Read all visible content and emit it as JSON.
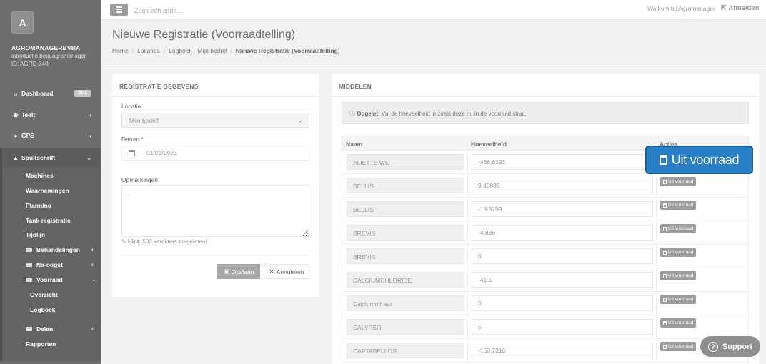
{
  "sidebar": {
    "avatar_letter": "A",
    "company": "AGROMANAGERBVBA",
    "domain": "introductie.beta.agromanager",
    "id": "ID: AGRO-340",
    "nav": [
      {
        "label": "Dashboard",
        "icon": "home-icon",
        "badge": "Beta"
      },
      {
        "label": "Teelt",
        "icon": "leaf-icon"
      },
      {
        "label": "GPS",
        "icon": "map-marker-icon"
      },
      {
        "label": "Spuitschrift",
        "icon": "tint-icon"
      }
    ],
    "sub": [
      "Machines",
      "Waarnemingen",
      "Planning",
      "Tank registratie",
      "Tijdlijn"
    ],
    "folders": [
      "Behandelingen",
      "Na-oogst",
      "Voorraad"
    ],
    "voorraad_sub": [
      "Overzicht",
      "Logboek"
    ],
    "delen": "Delen",
    "rapporten": "Rapporten"
  },
  "topbar": {
    "search_placeholder": "Zoek een code...",
    "welcome": "Welkom bij Agromanager",
    "logout": "Afmelden"
  },
  "page": {
    "title": "Nieuwe Registratie (Voorraadtelling)",
    "breadcrumb": [
      "Home",
      "Locaties",
      "Logboek - Mijn bedrijf",
      "Nieuwe Registratie (Voorraadtelling)"
    ]
  },
  "form": {
    "title": "REGISTRATIE GEGEVENS",
    "locatie_label": "Locatie",
    "locatie_value": "Mijn bedrijf",
    "datum_label": "Datum *",
    "datum_value": "01/01/2023",
    "opmerkingen_label": "Opmerkingen",
    "opmerkingen_placeholder": "...",
    "hint_label": "Hint:",
    "hint_text": "500 karakters toegelaten!",
    "save": "Opslaan",
    "cancel": "Annuleren"
  },
  "middelen": {
    "title": "MIDDELEN",
    "alert_label": "Opgelet!",
    "alert_text": "Vul de hoeveelheid in zoals deze nu in de voorraad staat.",
    "headers": [
      "Naam",
      "Hoeveelheid",
      "Acties"
    ],
    "action_label": "Uit voorraad",
    "rows": [
      {
        "name": "ALIETTE WG",
        "qty": "-466.6291"
      },
      {
        "name": "BELLIS",
        "qty": "9.40635"
      },
      {
        "name": "BELLIS",
        "qty": "-18.3799"
      },
      {
        "name": "BREVIS",
        "qty": "-4.836"
      },
      {
        "name": "BREVIS",
        "qty": "0"
      },
      {
        "name": "CALCIUMCHLORIDE",
        "qty": "-41.5"
      },
      {
        "name": "Calciumnitraat",
        "qty": "0"
      },
      {
        "name": "CALYPSO",
        "qty": "5"
      },
      {
        "name": "CAPTABELLOS",
        "qty": "-160.7316"
      }
    ]
  },
  "zoom_label": "Uit voorraad",
  "support": "Support"
}
